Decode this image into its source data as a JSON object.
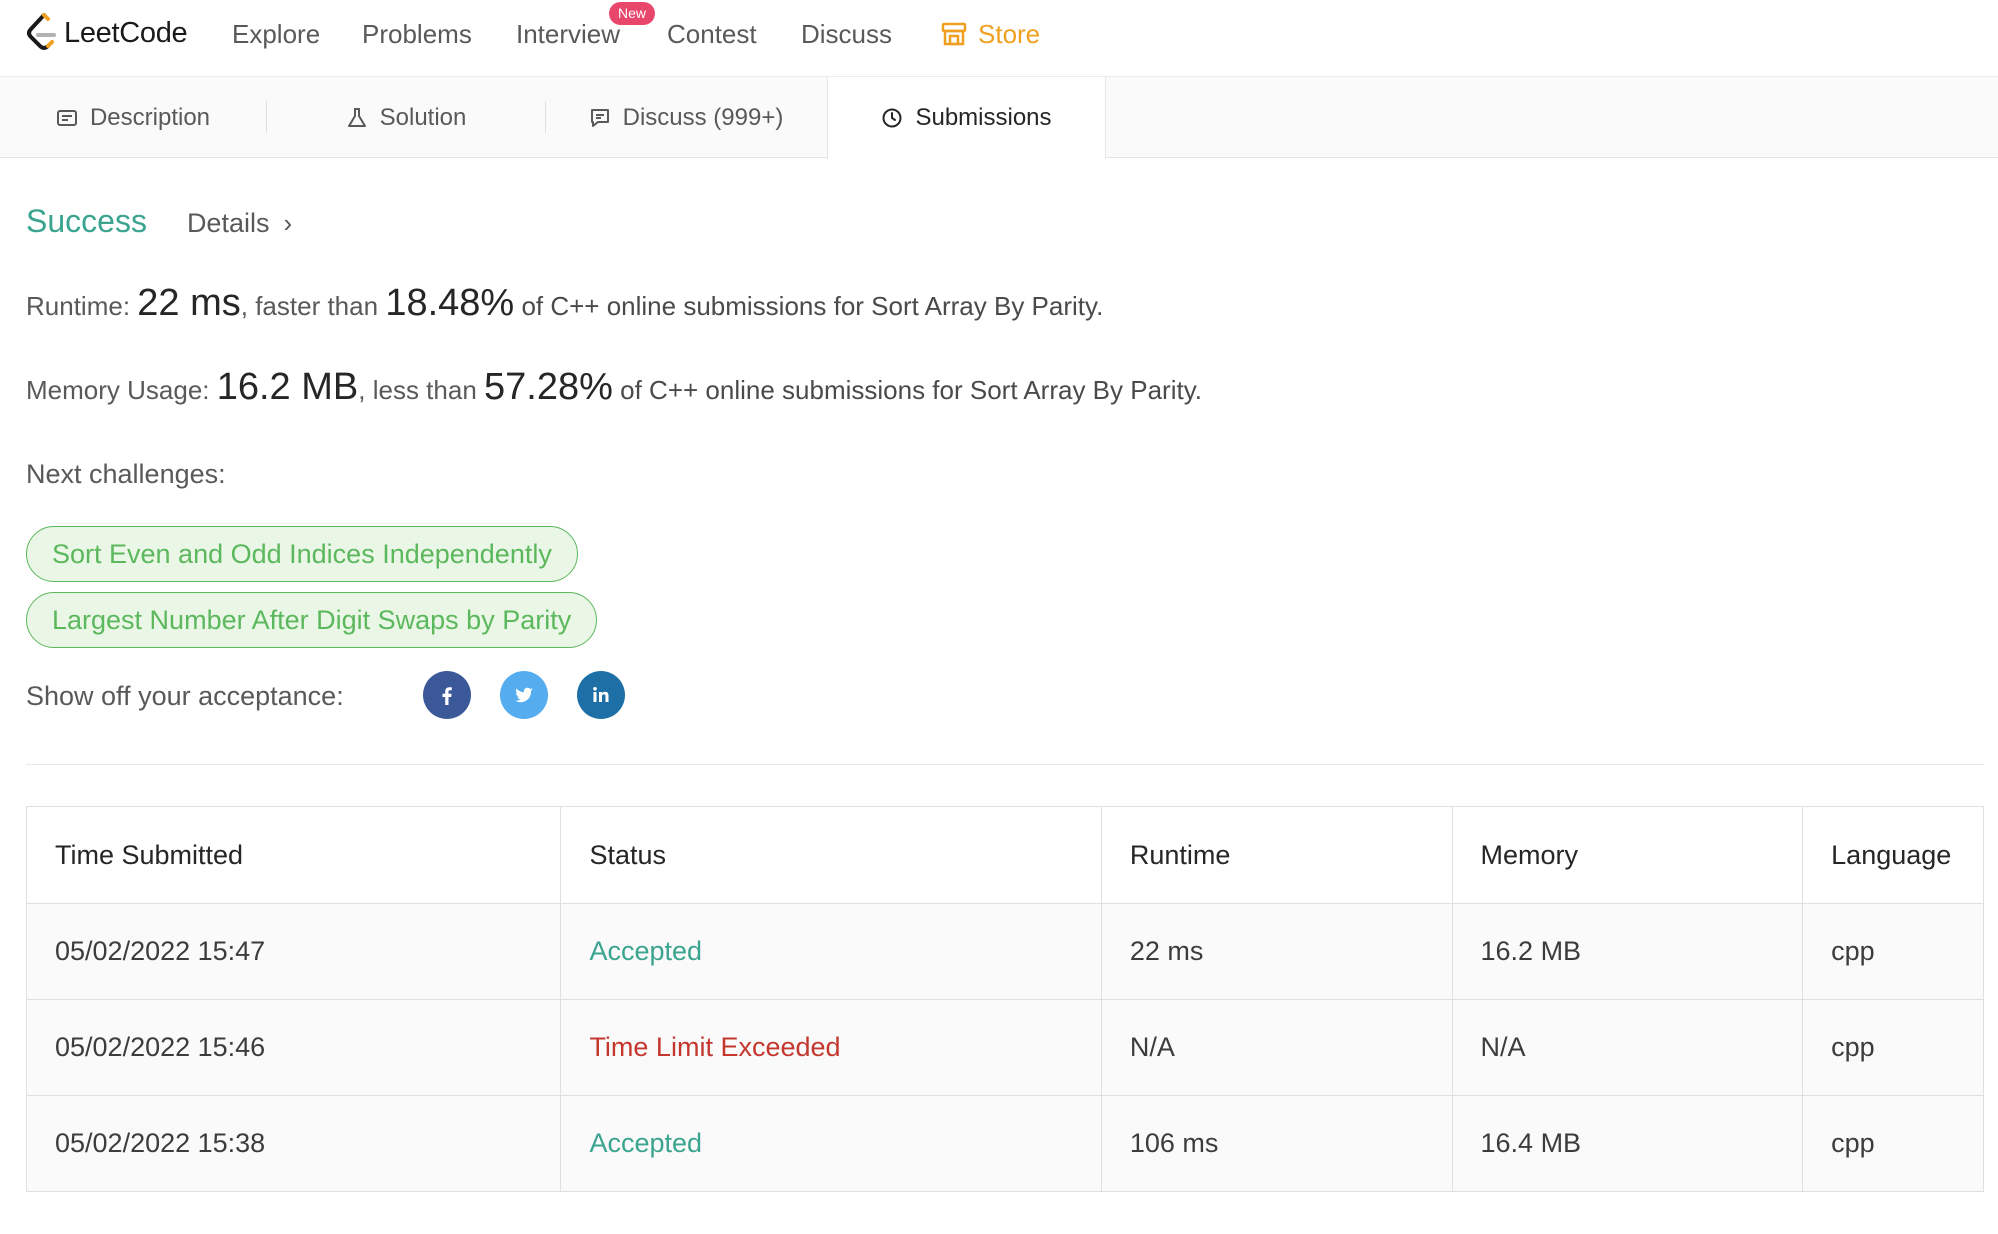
{
  "nav": {
    "logo_text": "LeetCode",
    "items": [
      "Explore",
      "Problems",
      "Interview",
      "Contest",
      "Discuss"
    ],
    "new_badge": "New",
    "store": "Store"
  },
  "tabs": [
    {
      "label": "Description",
      "icon": "description-icon"
    },
    {
      "label": "Solution",
      "icon": "flask-icon"
    },
    {
      "label": "Discuss (999+)",
      "icon": "comment-icon"
    },
    {
      "label": "Submissions",
      "icon": "clock-icon",
      "active": true
    }
  ],
  "result": {
    "status": "Success",
    "details_label": "Details",
    "runtime_label": "Runtime:",
    "runtime_value": "22 ms",
    "runtime_compare": ", faster than",
    "runtime_percent": "18.48%",
    "runtime_suffix": "of C++ online submissions for Sort Array By Parity.",
    "memory_label": "Memory Usage:",
    "memory_value": "16.2 MB",
    "memory_compare": ", less than",
    "memory_percent": "57.28%",
    "memory_suffix": "of C++ online submissions for Sort Array By Parity."
  },
  "next": {
    "label": "Next challenges:",
    "challenges": [
      "Sort Even and Odd Indices Independently",
      "Largest Number After Digit Swaps by Parity"
    ]
  },
  "share": {
    "label": "Show off your acceptance:",
    "icons": [
      "facebook-icon",
      "twitter-icon",
      "linkedin-icon"
    ],
    "colors": {
      "facebook": "#3b5998",
      "twitter": "#55acee",
      "linkedin": "#1d6fa5"
    }
  },
  "table": {
    "headers": [
      "Time Submitted",
      "Status",
      "Runtime",
      "Memory",
      "Language"
    ],
    "rows": [
      {
        "time": "05/02/2022 15:47",
        "status": "Accepted",
        "runtime": "22 ms",
        "memory": "16.2 MB",
        "language": "cpp"
      },
      {
        "time": "05/02/2022 15:46",
        "status": "Time Limit Exceeded",
        "runtime": "N/A",
        "memory": "N/A",
        "language": "cpp"
      },
      {
        "time": "05/02/2022 15:38",
        "status": "Accepted",
        "runtime": "106 ms",
        "memory": "16.4 MB",
        "language": "cpp"
      }
    ]
  },
  "colors": {
    "accepted": "#3aa48f",
    "tle": "#c4372f",
    "store": "#f0a020",
    "pill_green": "#5cb85c"
  }
}
